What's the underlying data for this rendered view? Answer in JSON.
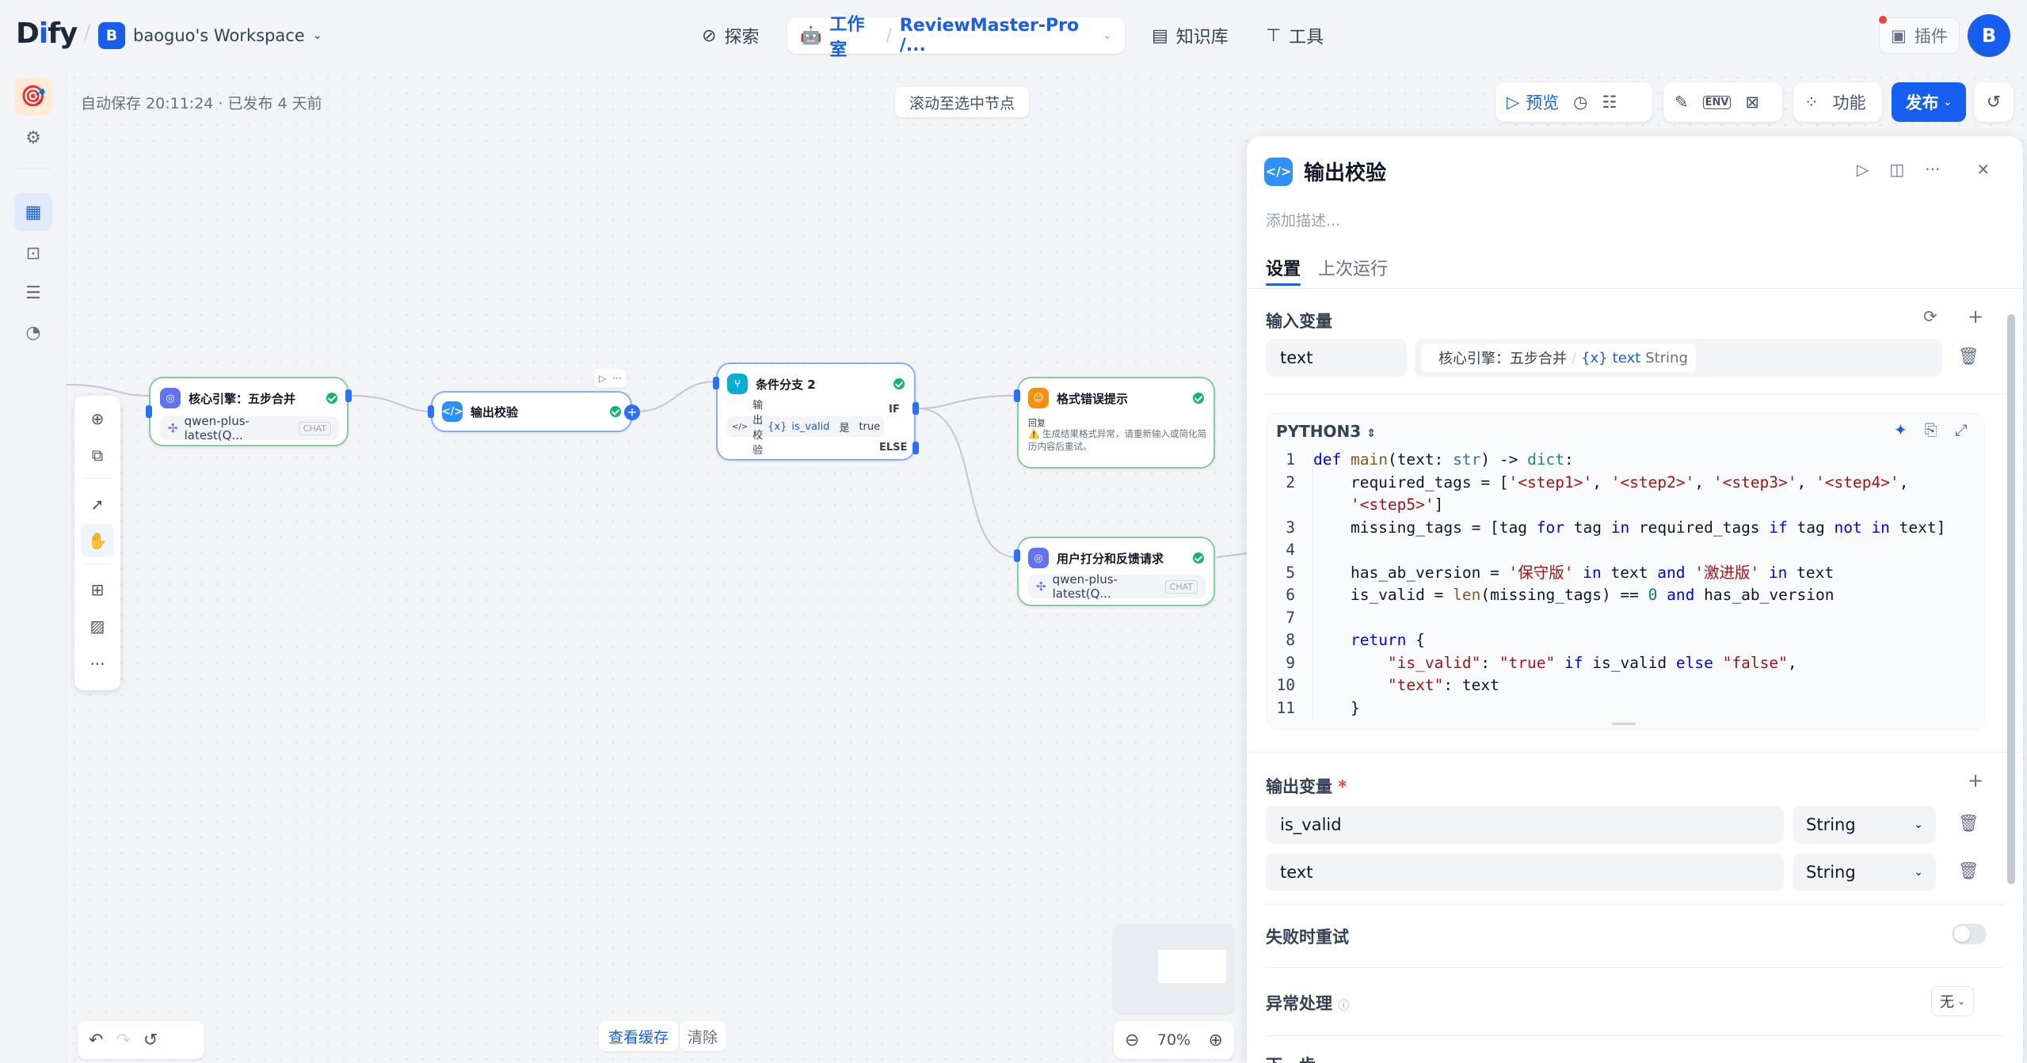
{
  "app": {
    "logo_pre": "D",
    "logo_i": "i",
    "logo_post": "fy"
  },
  "workspace": {
    "avatar": "B",
    "name": "baoguo's Workspace"
  },
  "nav": {
    "explore": "探索",
    "studio": "工作室",
    "app_name": "ReviewMaster-Pro /...",
    "knowledge": "知识库",
    "tools": "工具"
  },
  "plugins": {
    "label": "插件"
  },
  "user": {
    "avatar": "B"
  },
  "status": {
    "autosave": "自动保存 20:11:24 · 已发布 4 天前",
    "scroll_to_node": "滚动至选中节点"
  },
  "toolbar": {
    "preview": "预览",
    "env": "ENV",
    "features": "功能",
    "publish": "发布"
  },
  "nodes": {
    "core": {
      "title": "核心引擎：五步合并",
      "model": "qwen-plus-latest(Q...",
      "badge": "CHAT"
    },
    "validate": {
      "title": "输出校验"
    },
    "branch": {
      "title": "条件分支 2",
      "if": "IF",
      "else": "ELSE",
      "cond_node": "输出校验",
      "cond_var": "is_valid",
      "cond_op": "是",
      "cond_val": "true"
    },
    "error": {
      "title": "格式错误提示",
      "sub": "回复",
      "msg": "⚠️ 生成结果格式异常，请重新输入或简化简历内容后重试。"
    },
    "feedback": {
      "title": "用户打分和反馈请求",
      "model": "qwen-plus-latest(Q...",
      "badge": "CHAT"
    }
  },
  "bottom": {
    "view_cache": "查看缓存",
    "clear": "清除",
    "zoom": "70%"
  },
  "panel": {
    "title": "输出校验",
    "desc_placeholder": "添加描述...",
    "tabs": [
      "设置",
      "上次运行"
    ],
    "input_section": "输入变量",
    "input_var": {
      "name": "text",
      "src_node": "核心引擎：五步合并",
      "src_var": "text",
      "src_type": "String"
    },
    "lang": "PYTHON3",
    "output_section": "输出变量",
    "required_mark": "*",
    "outputs": [
      {
        "name": "is_valid",
        "type": "String"
      },
      {
        "name": "text",
        "type": "String"
      }
    ],
    "retry": "失败时重试",
    "error_handling": "异常处理",
    "error_value": "无",
    "next_step": "下一步"
  },
  "icons": [
    "explore-icon",
    "robot-icon",
    "book-icon",
    "tool-icon",
    "plugin-icon",
    "play-icon",
    "close-icon",
    "trash-icon",
    "plus-icon",
    "refresh-icon",
    "sparkle-icon",
    "copy-icon",
    "expand-icon"
  ]
}
